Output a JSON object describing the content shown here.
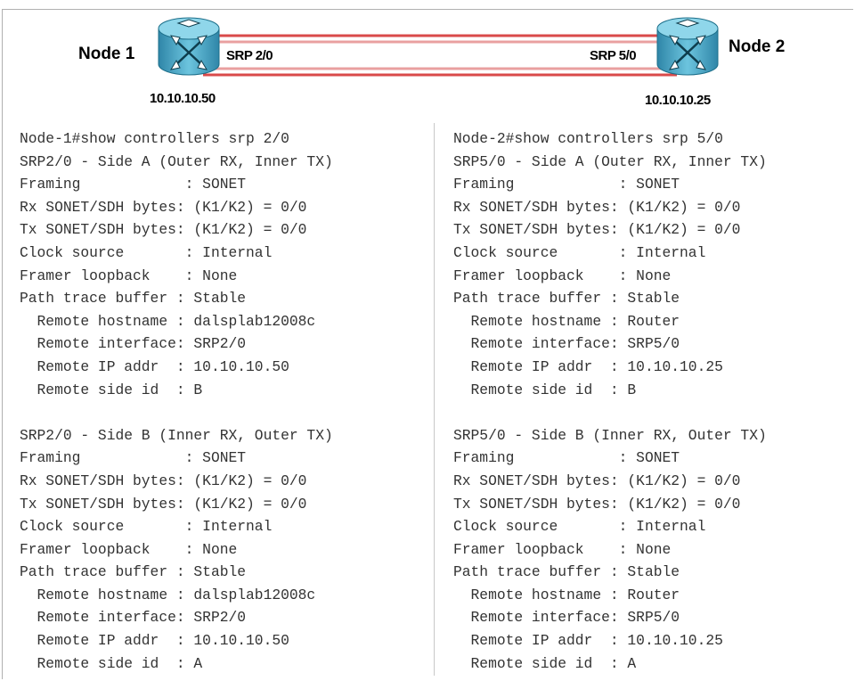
{
  "diagram": {
    "node1": {
      "name": "Node 1",
      "port": "SRP 2/0",
      "ip": "10.10.10.50"
    },
    "node2": {
      "name": "Node 2",
      "port": "SRP 5/0",
      "ip": "10.10.10.25"
    },
    "colors": {
      "link": "#d94a4a",
      "router": "#3aa0c0",
      "router_dark": "#1d6f8a"
    }
  },
  "left_output": {
    "lines": [
      "Node-1#show controllers srp 2/0",
      "SRP2/0 - Side A (Outer RX, Inner TX)",
      "Framing            : SONET",
      "Rx SONET/SDH bytes: (K1/K2) = 0/0",
      "Tx SONET/SDH bytes: (K1/K2) = 0/0",
      "Clock source       : Internal",
      "Framer loopback    : None",
      "Path trace buffer : Stable",
      "  Remote hostname : dalsplab12008c",
      "  Remote interface: SRP2/0",
      "  Remote IP addr  : 10.10.10.50",
      "  Remote side id  : B",
      "",
      "SRP2/0 - Side B (Inner RX, Outer TX)",
      "Framing            : SONET",
      "Rx SONET/SDH bytes: (K1/K2) = 0/0",
      "Tx SONET/SDH bytes: (K1/K2) = 0/0",
      "Clock source       : Internal",
      "Framer loopback    : None",
      "Path trace buffer : Stable",
      "  Remote hostname : dalsplab12008c",
      "  Remote interface: SRP2/0",
      "  Remote IP addr  : 10.10.10.50",
      "  Remote side id  : A"
    ]
  },
  "right_output": {
    "lines": [
      "Node-2#show controllers srp 5/0",
      "SRP5/0 - Side A (Outer RX, Inner TX)",
      "Framing            : SONET",
      "Rx SONET/SDH bytes: (K1/K2) = 0/0",
      "Tx SONET/SDH bytes: (K1/K2) = 0/0",
      "Clock source       : Internal",
      "Framer loopback    : None",
      "Path trace buffer : Stable",
      "  Remote hostname : Router",
      "  Remote interface: SRP5/0",
      "  Remote IP addr  : 10.10.10.25",
      "  Remote side id  : B",
      "",
      "SRP5/0 - Side B (Inner RX, Outer TX)",
      "Framing            : SONET",
      "Rx SONET/SDH bytes: (K1/K2) = 0/0",
      "Tx SONET/SDH bytes: (K1/K2) = 0/0",
      "Clock source       : Internal",
      "Framer loopback    : None",
      "Path trace buffer : Stable",
      "  Remote hostname : Router",
      "  Remote interface: SRP5/0",
      "  Remote IP addr  : 10.10.10.25",
      "  Remote side id  : A"
    ]
  }
}
